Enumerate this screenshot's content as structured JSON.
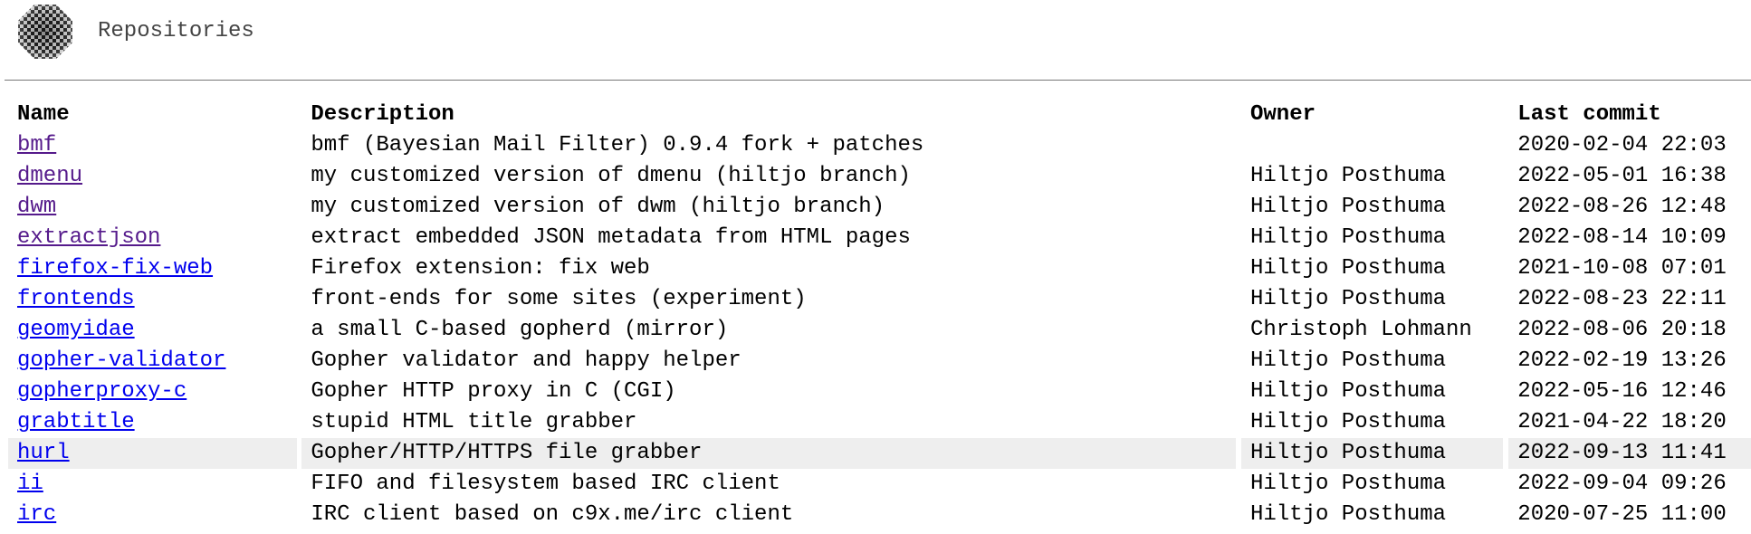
{
  "header": {
    "title": "Repositories",
    "logo_icon": "checkered-sphere-logo-icon"
  },
  "table": {
    "columns": [
      "Name",
      "Description",
      "Owner",
      "Last commit"
    ],
    "rows": [
      {
        "name": "bmf",
        "description": "bmf (Bayesian Mail Filter) 0.9.4 fork + patches",
        "owner": "",
        "last_commit": "2020-02-04 22:03",
        "visited": true
      },
      {
        "name": "dmenu",
        "description": "my customized version of dmenu (hiltjo branch)",
        "owner": "Hiltjo Posthuma",
        "last_commit": "2022-05-01 16:38",
        "visited": true
      },
      {
        "name": "dwm",
        "description": "my customized version of dwm (hiltjo branch)",
        "owner": "Hiltjo Posthuma",
        "last_commit": "2022-08-26 12:48",
        "visited": true
      },
      {
        "name": "extractjson",
        "description": "extract embedded JSON metadata from HTML pages",
        "owner": "Hiltjo Posthuma",
        "last_commit": "2022-08-14 10:09",
        "visited": true
      },
      {
        "name": "firefox-fix-web",
        "description": "Firefox extension: fix web",
        "owner": "Hiltjo Posthuma",
        "last_commit": "2021-10-08 07:01",
        "visited": false
      },
      {
        "name": "frontends",
        "description": "front-ends for some sites (experiment)",
        "owner": "Hiltjo Posthuma",
        "last_commit": "2022-08-23 22:11",
        "visited": false
      },
      {
        "name": "geomyidae",
        "description": "a small C-based gopherd (mirror)",
        "owner": "Christoph Lohmann",
        "last_commit": "2022-08-06 20:18",
        "visited": false
      },
      {
        "name": "gopher-validator",
        "description": "Gopher validator and happy helper",
        "owner": "Hiltjo Posthuma",
        "last_commit": "2022-02-19 13:26",
        "visited": false
      },
      {
        "name": "gopherproxy-c",
        "description": "Gopher HTTP proxy in C (CGI)",
        "owner": "Hiltjo Posthuma",
        "last_commit": "2022-05-16 12:46",
        "visited": false
      },
      {
        "name": "grabtitle",
        "description": "stupid HTML title grabber",
        "owner": "Hiltjo Posthuma",
        "last_commit": "2021-04-22 18:20",
        "visited": false
      },
      {
        "name": "hurl",
        "description": "Gopher/HTTP/HTTPS file grabber",
        "owner": "Hiltjo Posthuma",
        "last_commit": "2022-09-13 11:41",
        "visited": false,
        "highlighted": true
      },
      {
        "name": "ii",
        "description": "FIFO and filesystem based IRC client",
        "owner": "Hiltjo Posthuma",
        "last_commit": "2022-09-04 09:26",
        "visited": false
      },
      {
        "name": "irc",
        "description": "IRC client based on c9x.me/irc client",
        "owner": "Hiltjo Posthuma",
        "last_commit": "2020-07-25 11:00",
        "visited": false
      }
    ]
  },
  "colors": {
    "link": "#0000ee",
    "visited_link": "#551a8b",
    "row_highlight": "#eeeeee",
    "title_text": "#444444"
  }
}
